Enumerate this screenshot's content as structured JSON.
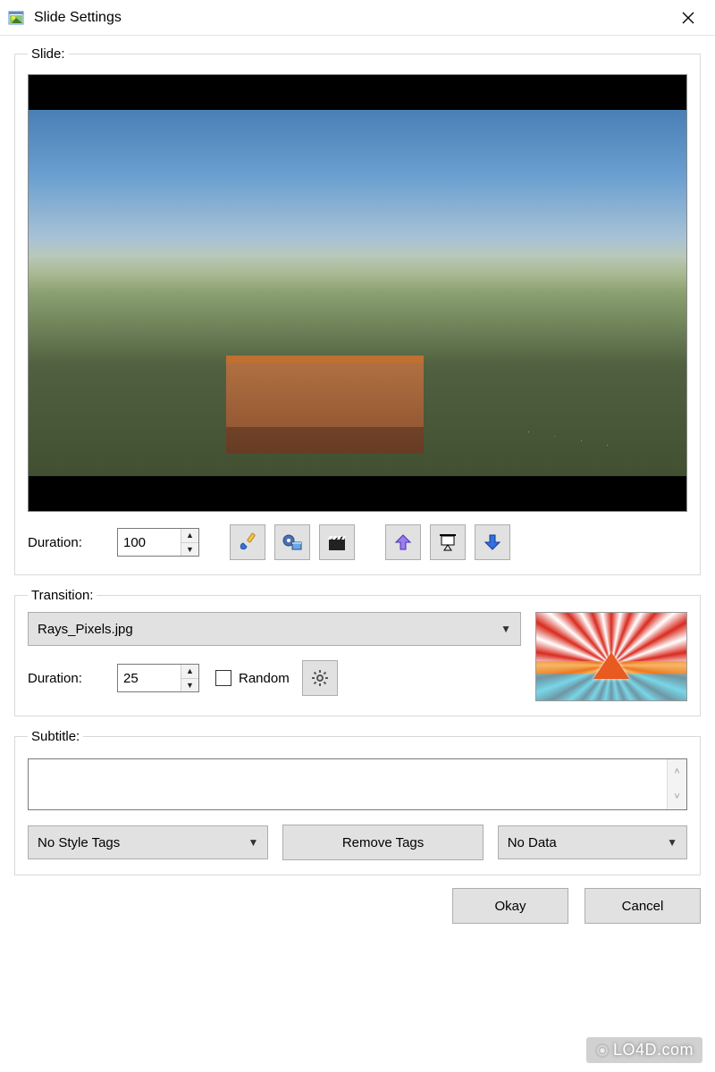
{
  "window": {
    "title": "Slide Settings"
  },
  "slide": {
    "legend": "Slide:",
    "duration_label": "Duration:",
    "duration_value": "100"
  },
  "toolbar": {
    "brush": "paintbrush-icon",
    "film_roll": "film-roll-icon",
    "clapper": "clapperboard-icon",
    "move_up": "arrow-up-icon",
    "presentation": "presentation-icon",
    "move_down": "arrow-down-icon"
  },
  "transition": {
    "legend": "Transition:",
    "selected": "Rays_Pixels.jpg",
    "duration_label": "Duration:",
    "duration_value": "25",
    "random_label": "Random",
    "random_checked": false,
    "settings": "gear-icon"
  },
  "subtitle": {
    "legend": "Subtitle:",
    "text": "",
    "style_combo": "No Style Tags",
    "remove_btn": "Remove Tags",
    "data_combo": "No Data"
  },
  "footer": {
    "ok": "Okay",
    "cancel": "Cancel"
  },
  "watermark": "LO4D.com"
}
